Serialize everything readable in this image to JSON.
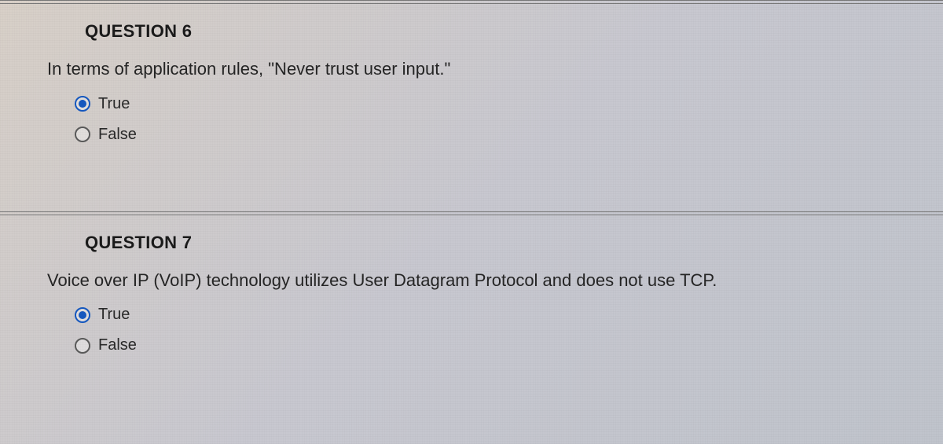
{
  "questions": [
    {
      "heading": "QUESTION 6",
      "prompt": "In terms of application rules, \"Never trust user input.\"",
      "options": [
        {
          "label": "True",
          "selected": true
        },
        {
          "label": "False",
          "selected": false
        }
      ]
    },
    {
      "heading": "QUESTION 7",
      "prompt": "Voice over IP (VoIP) technology utilizes User Datagram Protocol and does not use TCP.",
      "options": [
        {
          "label": "True",
          "selected": true
        },
        {
          "label": "False",
          "selected": false
        }
      ]
    }
  ]
}
